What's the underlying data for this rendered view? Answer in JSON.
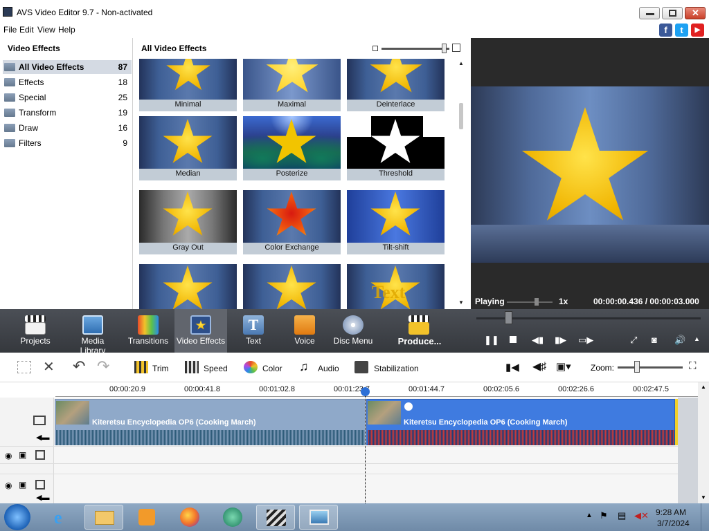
{
  "window": {
    "title": "AVS Video Editor 9.7 - Non-activated",
    "min": "▬",
    "max": "❐",
    "close": "✕"
  },
  "menu": [
    "File",
    "Edit",
    "View",
    "Help"
  ],
  "social": [
    "f",
    "t",
    "▶"
  ],
  "left_panel": {
    "title": "Video Effects",
    "categories": [
      {
        "label": "All Video Effects",
        "count": "87",
        "selected": true
      },
      {
        "label": "Effects",
        "count": "18"
      },
      {
        "label": "Special",
        "count": "25"
      },
      {
        "label": "Transform",
        "count": "19"
      },
      {
        "label": "Draw",
        "count": "16"
      },
      {
        "label": "Filters",
        "count": "9"
      }
    ]
  },
  "grid": {
    "title": "All Video Effects",
    "tiles": [
      "Minimal",
      "Maximal",
      "Deinterlace",
      "Median",
      "Posterize",
      "Threshold",
      "Gray Out",
      "Color Exchange",
      "Tilt-shift"
    ],
    "partial_tile_text": "Text"
  },
  "preview": {
    "status": "Playing",
    "speed": "1x",
    "time": "00:00:00.436 / 00:00:03.000"
  },
  "toolbar": {
    "tools": [
      "Projects",
      "Media Library",
      "Transitions",
      "Video Effects",
      "Text",
      "Voice",
      "Disc Menu",
      "Produce..."
    ],
    "active": "Video Effects"
  },
  "edit_bar": {
    "trim": "Trim",
    "speed": "Speed",
    "color": "Color",
    "audio": "Audio",
    "stabilization": "Stabilization",
    "zoom": "Zoom:"
  },
  "ruler": [
    "00:00:20.9",
    "00:00:41.8",
    "00:01:02.8",
    "00:01:23.7",
    "00:01:44.7",
    "00:02:05.6",
    "00:02:26.6",
    "00:02:47.5"
  ],
  "clips": [
    {
      "title": "Kiteretsu Encyclopedia OP6 (Cooking March)"
    },
    {
      "title": "Kiteretsu Encyclopedia OP6 (Cooking March)"
    }
  ],
  "taskbar": {
    "time": "9:28 AM",
    "date": "3/7/2024"
  }
}
